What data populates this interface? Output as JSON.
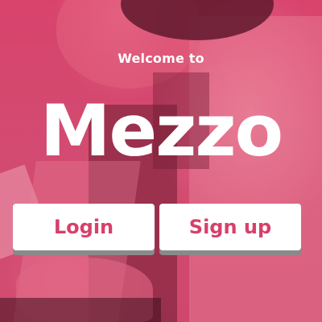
{
  "screen": {
    "welcome_text": "Welcome to",
    "brand_name": "Mezzo"
  },
  "buttons": {
    "login_label": "Login",
    "signup_label": "Sign up"
  },
  "colors": {
    "brand_pink": "#d7406a",
    "background_tint": "#d84a72",
    "button_background": "#ffffff",
    "button_shadow": "#8a8a8a",
    "text_white": "#ffffff"
  }
}
